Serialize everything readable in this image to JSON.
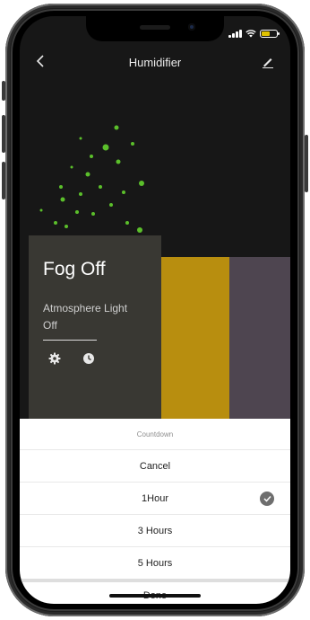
{
  "app": {
    "title": "Humidifier"
  },
  "nav": {
    "back_icon": "chevron-left-icon",
    "edit_icon": "pencil-icon"
  },
  "device": {
    "fog_status": "Fog Off",
    "light_label": "Atmosphere Light",
    "light_status": "Off",
    "settings_icon": "gear-icon",
    "timer_icon": "clock-icon"
  },
  "sheet": {
    "header": "Countdown",
    "options": [
      "Cancel",
      "1Hour",
      "3 Hours",
      "5 Hours"
    ],
    "selected": "1Hour",
    "done_label": "Done"
  },
  "colors": {
    "accent_green": "#5bbf2b",
    "yellow_panel": "#b88e0f",
    "purple_panel": "#4e4550",
    "check_gray": "#6e6e6e"
  }
}
